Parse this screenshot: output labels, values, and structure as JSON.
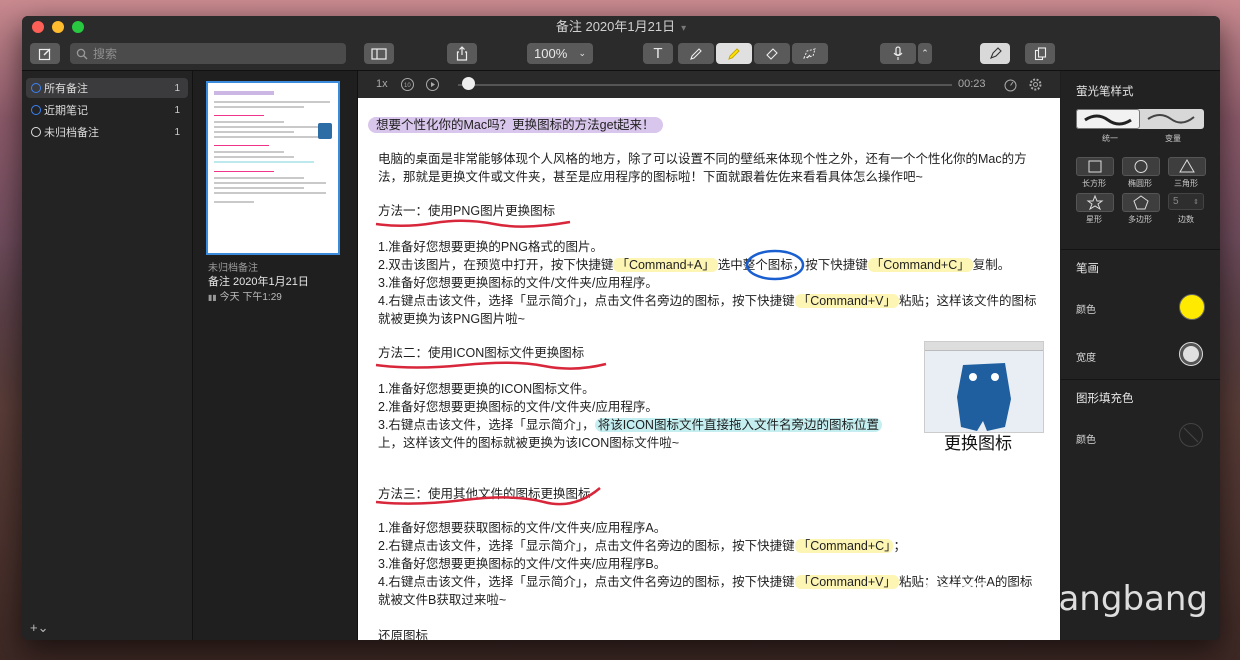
{
  "window": {
    "title": "备注 2020年1月21日"
  },
  "toolbar": {
    "search_placeholder": "搜索",
    "zoom_value": "100%",
    "text_tool_label": "T"
  },
  "sidebar": {
    "items": [
      {
        "label": "所有备注",
        "count": "1"
      },
      {
        "label": "近期笔记",
        "count": "1"
      },
      {
        "label": "未归档备注",
        "count": "1"
      }
    ],
    "add_label": "+⌄"
  },
  "note_list": {
    "folder": "未归档备注",
    "title": "备注 2020年1月21日",
    "date": "今天 下午1:29"
  },
  "player": {
    "speed": "1x",
    "time": "00:23",
    "progress": 0.02
  },
  "document": {
    "title": "想要个性化你的Mac吗？更换图标的方法get起来！",
    "intro": "电脑的桌面是非常能够体现个人风格的地方，除了可以设置不同的壁纸来体现个性之外，还有一个个性化你的Mac的方法，那就是更换文件或文件夹，甚至是应用程序的图标啦！下面就跟着佐佐来看看具体怎么操作吧~",
    "method1": {
      "heading": "方法一：使用PNG图片更换图标",
      "s1": "1.准备好您想要更换的PNG格式的图片。",
      "s2a": "2.双击该图片，在预览中打开，按下快捷键",
      "s2b": "「Command+A」",
      "s2c": "选中整个图标，按下快捷键",
      "s2d": "「Command+C」",
      "s2e": "复制。",
      "s3": "3.准备好您想要更换图标的文件/文件夹/应用程序。",
      "s4a": "4.右键点击该文件，选择「显示简介」，点击文件名旁边的图标，按下快捷键",
      "s4b": "「Command+V」",
      "s4c": "粘贴；这样该文件的图标就被更换为该PNG图片啦~"
    },
    "method2": {
      "heading": "方法二：使用ICON图标文件更换图标",
      "s1": "1.准备好您想要更换的ICON图标文件。",
      "s2": "2.准备好您想要更换图标的文件/文件夹/应用程序。",
      "s3a": "3.右键点击该文件，选择「显示简介」，",
      "s3b": "将该ICON图标文件直接拖入文件名旁边的图标位置",
      "s3c": "上，这样该文件的图标就被更换为该ICON图标文件啦~"
    },
    "method3": {
      "heading": "方法三：使用其他文件的图标更换图标",
      "s1": "1.准备好您想要获取图标的文件/文件夹/应用程序A。",
      "s2a": "2.右键点击该文件，选择「显示简介」，点击文件名旁边的图标，按下快捷键",
      "s2b": "「Command+C」",
      "s2c": "；",
      "s3": "3.准备好您想要更换图标的文件/文件夹/应用程序B。",
      "s4a": "4.右键点击该文件，选择「显示简介」，点击文件名旁边的图标，按下快捷键",
      "s4b": "「Command+V」",
      "s4c": "粘贴；这样文件A的图标就被文件B获取过来啦~"
    },
    "footer": "还原图标",
    "image_caption": "更换图标"
  },
  "inspector": {
    "highlighter_style": "萤光笔样式",
    "style_uniform": "统一",
    "style_variable": "变量",
    "shapes": [
      "长方形",
      "椭圆形",
      "三角形",
      "星形",
      "多边形",
      "边数"
    ],
    "sides_value": "5",
    "stroke_heading": "笔画",
    "color_label": "颜色",
    "width_label": "宽度",
    "fill_heading": "图形填充色",
    "fill_color_label": "颜色",
    "colors": {
      "stroke": "#ffea00",
      "width": "#e0e0e0"
    }
  },
  "watermark": "知乎 @Bangbang"
}
